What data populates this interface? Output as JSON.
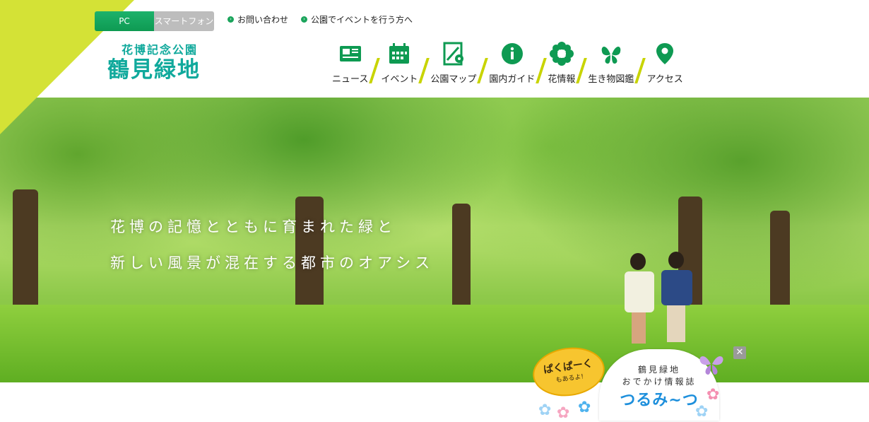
{
  "header": {
    "device_switch": {
      "pc": "PC",
      "smartphone": "スマートフォン"
    },
    "util_links": [
      {
        "label": "お問い合わせ"
      },
      {
        "label": "公園でイベントを行う方へ"
      }
    ],
    "logo": {
      "subtitle": "花博記念公園",
      "title": "鶴見緑地"
    },
    "nav": [
      {
        "label": "ニュース",
        "icon": "newspaper-icon"
      },
      {
        "label": "イベント",
        "icon": "calendar-icon"
      },
      {
        "label": "公園マップ",
        "icon": "map-icon"
      },
      {
        "label": "園内ガイド",
        "icon": "info-icon"
      },
      {
        "label": "花情報",
        "icon": "flower-icon"
      },
      {
        "label": "生き物図鑑",
        "icon": "butterfly-icon"
      },
      {
        "label": "アクセス",
        "icon": "map-pin-icon"
      }
    ]
  },
  "hero": {
    "line1": "花博の記憶とともに育まれた緑と",
    "line2": "新しい風景が混在する都市のオアシス"
  },
  "promo": {
    "bubble_title": "ぱくぱーく",
    "bubble_sub": "もあるよ!",
    "line1": "鶴見緑地",
    "line2": "おでかけ情報誌",
    "title": "つるみ~つ",
    "close": "✕"
  },
  "colors": {
    "brand_green": "#0e9a52",
    "logo_teal": "#10a99c",
    "accent_lime": "#d4e236"
  }
}
